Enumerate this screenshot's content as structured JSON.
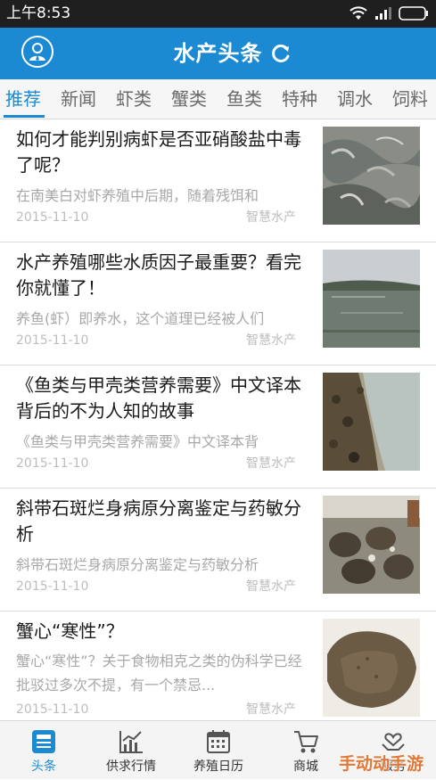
{
  "status_bar": {
    "time": "上午8:53"
  },
  "header": {
    "title": "水产头条"
  },
  "tabs": [
    {
      "label": "推荐",
      "active": true
    },
    {
      "label": "新闻"
    },
    {
      "label": "虾类"
    },
    {
      "label": "蟹类"
    },
    {
      "label": "鱼类"
    },
    {
      "label": "特种"
    },
    {
      "label": "调水"
    },
    {
      "label": "饲料"
    }
  ],
  "articles": [
    {
      "title": "如何才能判别病虾是否亚硝酸盐中毒了呢？",
      "snippet": "在南美白对虾养殖中后期，随着残饵和",
      "date": "2015-11-10",
      "source": "智慧水产"
    },
    {
      "title": "水产养殖哪些水质因子最重要？看完你就懂了！",
      "snippet": "养鱼(虾）即养水，这个道理已经被人们",
      "date": "2015-11-10",
      "source": "智慧水产"
    },
    {
      "title": "《鱼类与甲壳类营养需要》中文译本背后的不为人知的故事",
      "snippet": "《鱼类与甲壳类营养需要》中文译本背",
      "date": "2015-11-10",
      "source": "智慧水产"
    },
    {
      "title": "斜带石斑烂身病原分离鉴定与药敏分析",
      "snippet": "斜带石斑烂身病原分离鉴定与药敏分析",
      "date": "2015-11-10",
      "source": "智慧水产"
    },
    {
      "title": "蟹心“寒性”？",
      "snippet": "蟹心“寒性”？关于食物相克之类的伪科学已经批驳过多次不提，有一个禁忌...",
      "date": "2015-11-10",
      "source": "智慧水产"
    }
  ],
  "bottom_nav": [
    {
      "label": "头条",
      "icon": "news-icon",
      "active": true
    },
    {
      "label": "供求行情",
      "icon": "chart-icon"
    },
    {
      "label": "养殖日历",
      "icon": "calendar-icon"
    },
    {
      "label": "商城",
      "icon": "cart-icon"
    },
    {
      "label": "服务",
      "icon": "service-icon"
    }
  ],
  "watermark": "手动动手游",
  "colors": {
    "primary": "#1b8ad3",
    "statusbar": "#1f1f1f"
  }
}
